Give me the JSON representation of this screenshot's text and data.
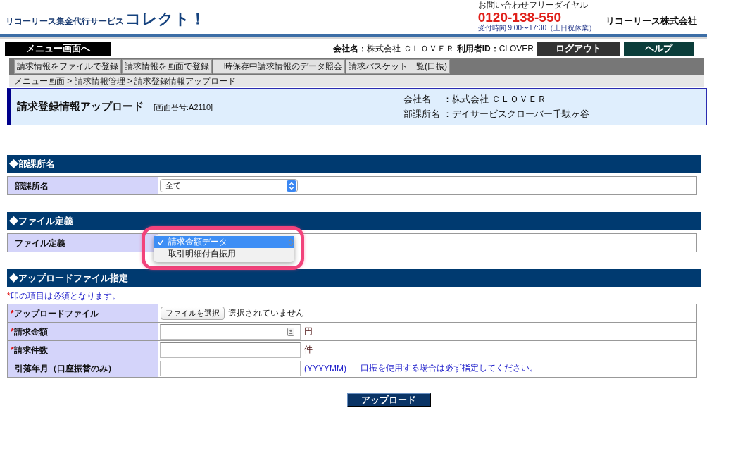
{
  "header": {
    "service_label": "リコーリース集金代行サービス",
    "logo": "コレクト！",
    "phone_caption": "お問い合わせフリーダイヤル",
    "phone": "0120-138-550",
    "hours": "受付時間 9:00〜17:30（土日祝休業）",
    "company": "リコーリース株式会社"
  },
  "user_bar": {
    "menu_button": "メニュー画面へ",
    "company_label": "会社名：",
    "company_value": "株式会社 ＣＬＯＶＥＲ",
    "user_label": "利用者ID：",
    "user_value": "CLOVER",
    "buttons": [
      {
        "label": "ログアウト",
        "kind": "logout"
      },
      {
        "label": "ヘルプ",
        "kind": "help"
      }
    ]
  },
  "nav_tabs": [
    {
      "label": "請求情報をファイルで登録"
    },
    {
      "label": "請求情報を画面で登録"
    },
    {
      "label": "一時保存中請求情報のデータ照会"
    },
    {
      "label": "請求バスケット一覧(口振)"
    }
  ],
  "breadcrumb": "メニュー画面 > 請求情報管理 > 請求登録情報アップロード",
  "page_header": {
    "title": "請求登録情報アップロード",
    "screen_number": "[画面番号:A2110]",
    "info": [
      {
        "label": "会社名",
        "value": "：株式会社 ＣＬＯＶＥＲ"
      },
      {
        "label": "部課所名",
        "value": "：デイサービスクローバー千駄ヶ谷"
      }
    ]
  },
  "sections": [
    {
      "title": "◆部課所名",
      "rows": [
        {
          "label": "部課所名",
          "kind": "select",
          "value": "全て"
        }
      ]
    },
    {
      "title": "◆ファイル定義",
      "rows": [
        {
          "label": "ファイル定義",
          "kind": "dropdown",
          "highlighted": true,
          "options": [
            {
              "label": "請求金額データ",
              "selected": true
            },
            {
              "label": "取引明細付自振用",
              "selected": false
            }
          ]
        }
      ]
    },
    {
      "title": "◆アップロードファイル指定",
      "note_mark": "*",
      "note": "印の項目は必須となります。",
      "rows": [
        {
          "label": "アップロードファイル",
          "required_mark": "*",
          "kind": "file",
          "button": "ファイルを選択",
          "status": "選択されていません"
        },
        {
          "label": "請求金額",
          "required_mark": "*",
          "kind": "text",
          "autofill": true,
          "unit": "円"
        },
        {
          "label": "請求件数",
          "required_mark": "*",
          "kind": "text",
          "autofill": false,
          "unit": "件"
        },
        {
          "label": "引落年月（口座振替のみ）",
          "kind": "text",
          "autofill": false,
          "format": "(YYYYMM)",
          "hint": "口振を使用する場合は必ず指定してください。"
        }
      ]
    }
  ],
  "submit_button": "アップロード"
}
